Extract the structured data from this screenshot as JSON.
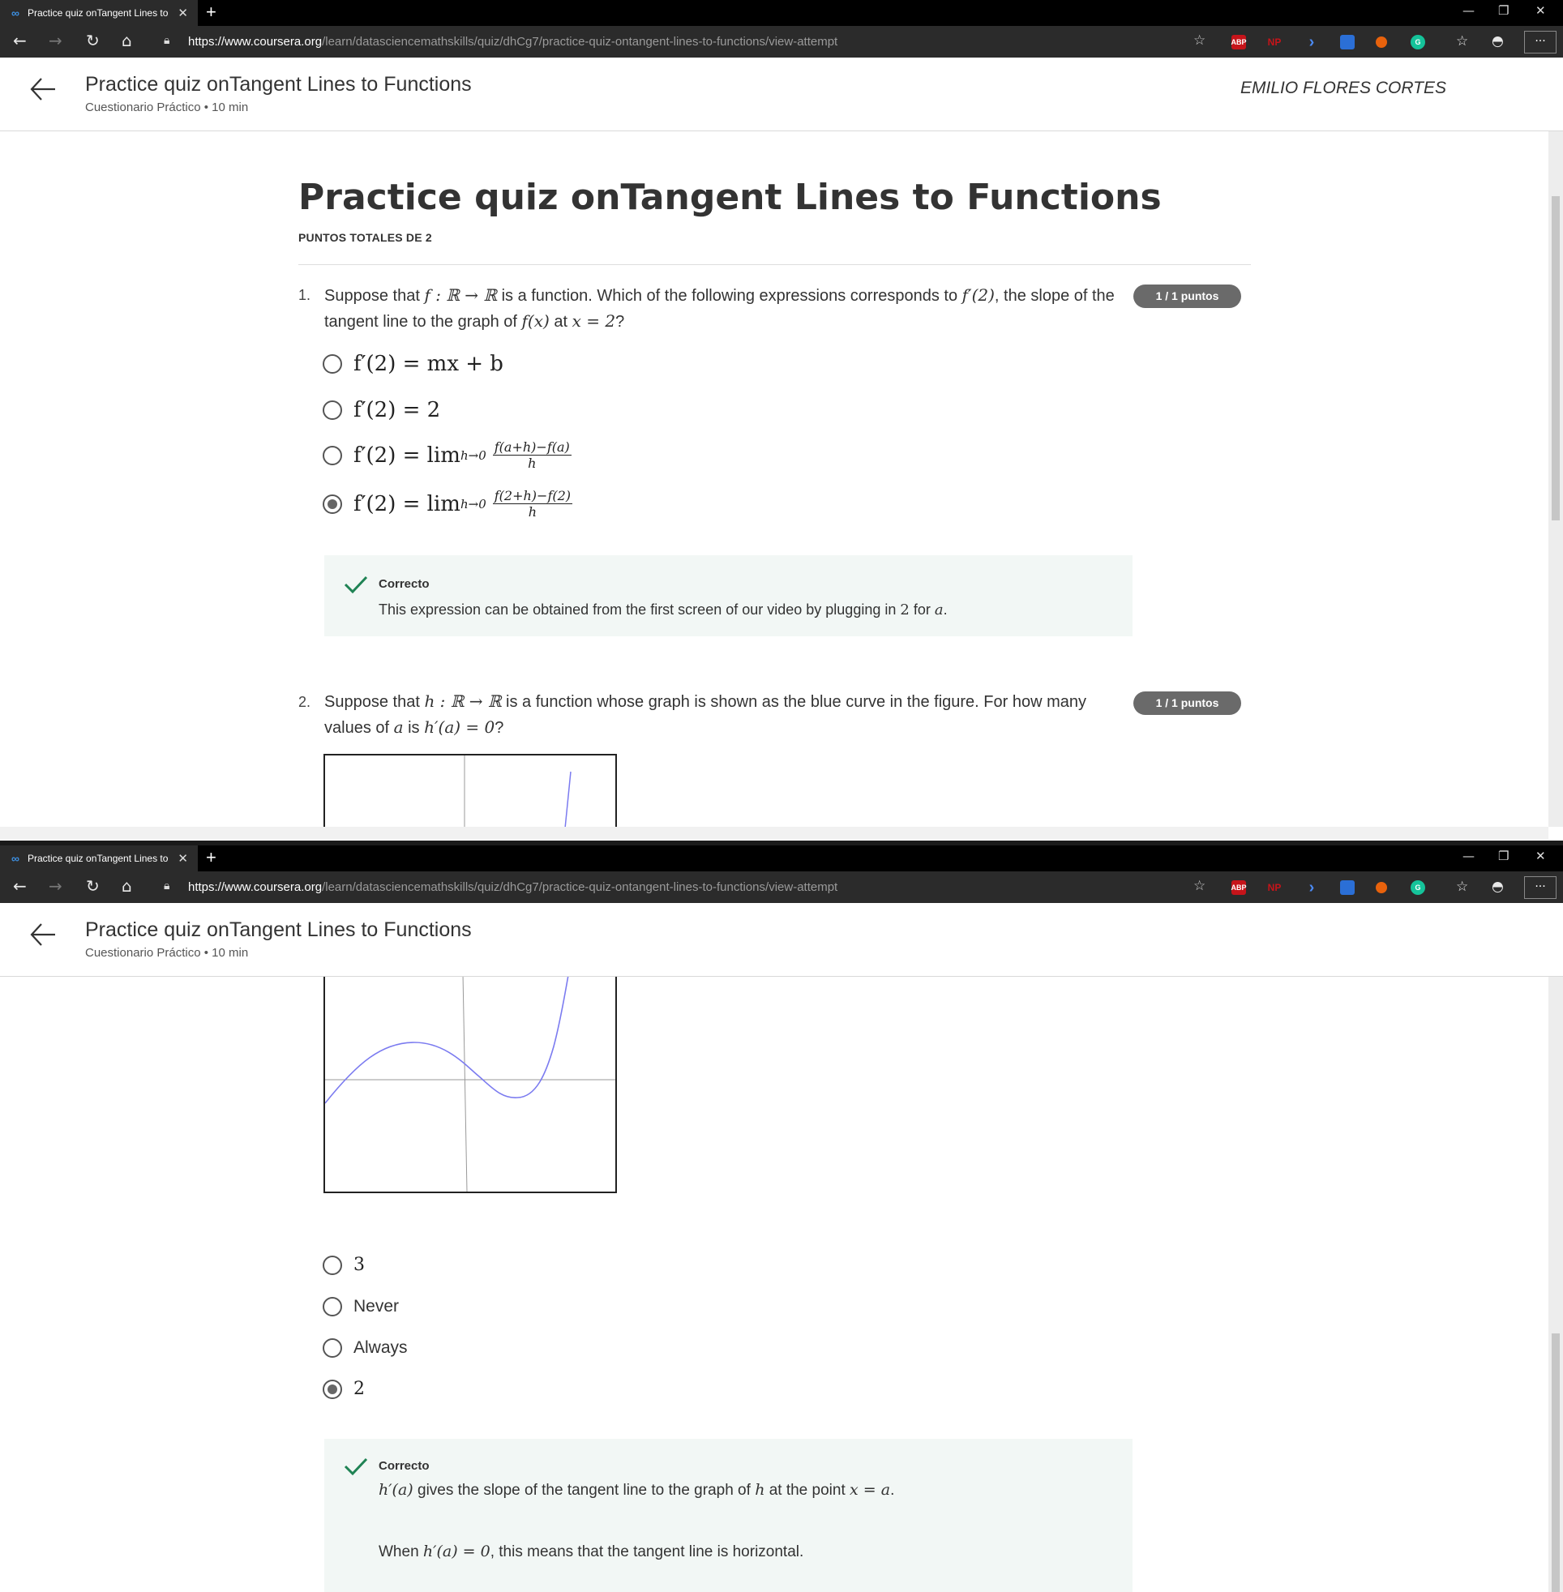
{
  "browser": {
    "tab_title": "Practice quiz onTangent Lines to",
    "tab_close": "✕",
    "new_tab": "+",
    "url_host": "https://www.coursera.org",
    "url_path": "/learn/datasciencemathskills/quiz/dhCg7/practice-quiz-ontangent-lines-to-functions/view-attempt",
    "menu_label": "···",
    "extensions": [
      {
        "name": "abp",
        "label": "ABP",
        "color": "#c6141a"
      },
      {
        "name": "np",
        "label": "NP",
        "color": "#c6141a"
      },
      {
        "name": "arrow",
        "label": "›",
        "color": "#2b6fd6"
      },
      {
        "name": "ext-blue",
        "label": "",
        "color": "#2b6fd6"
      },
      {
        "name": "ext-orange",
        "label": "",
        "color": "#e8620c"
      },
      {
        "name": "grammarly",
        "label": "G",
        "color": "#15c39a"
      }
    ]
  },
  "header": {
    "title": "Practice quiz onTangent Lines to Functions",
    "subtitle": "Cuestionario Práctico • 10 min",
    "user_name": "EMILIO FLORES CORTES"
  },
  "quiz": {
    "title": "Practice quiz onTangent Lines to Functions",
    "total_points": "PUNTOS TOTALES DE 2",
    "questions": [
      {
        "number": "1.",
        "text_a": "Suppose that ",
        "text_math1": "f : ℝ → ℝ",
        "text_b": " is a function. Which of the following expressions corresponds to ",
        "text_math2": "f′(2)",
        "text_c": ", the slope of the tangent line to the graph of ",
        "text_math3": "f(x)",
        "text_d": " at ",
        "text_math4": "x = 2",
        "text_e": "?",
        "badge": "1 / 1 puntos",
        "options": [
          {
            "label": "f′(2) = mx + b",
            "selected": false
          },
          {
            "label": "f′(2) = 2",
            "selected": false
          },
          {
            "label": "f′(2) = lim",
            "sub": "h→0",
            "num": "f(a+h)−f(a)",
            "den": "h",
            "selected": false
          },
          {
            "label": "f′(2) = lim",
            "sub": "h→0",
            "num": "f(2+h)−f(2)",
            "den": "h",
            "selected": true
          }
        ],
        "feedback_label": "Correcto",
        "feedback_a": "This expression can be obtained from the first screen of our video by plugging in ",
        "feedback_m1": "2",
        "feedback_b": " for ",
        "feedback_m2": "a",
        "feedback_c": "."
      },
      {
        "number": "2.",
        "text_a": "Suppose that ",
        "text_math1": "h : ℝ → ℝ",
        "text_b": " is a function whose graph is shown as the blue curve in the figure. For how many values of ",
        "text_math2": "a",
        "text_c": " is ",
        "text_math3": "h′(a) = 0",
        "text_d": "?",
        "badge": "1 / 1 puntos",
        "options": [
          {
            "label": "3",
            "selected": false,
            "math": true
          },
          {
            "label": "Never",
            "selected": false,
            "math": false
          },
          {
            "label": "Always",
            "selected": false,
            "math": false
          },
          {
            "label": "2",
            "selected": true,
            "math": true
          }
        ],
        "feedback_label": "Correcto",
        "feedback_line1_m1": "h′(a)",
        "feedback_line1_a": " gives the slope of the tangent line to the graph of ",
        "feedback_line1_m2": "h",
        "feedback_line1_b": " at the point ",
        "feedback_line1_m3": "x = a",
        "feedback_line1_c": ".",
        "feedback_line2_a": "When ",
        "feedback_line2_m1": "h′(a) = 0",
        "feedback_line2_b": ", this means that the tangent line is horizontal."
      }
    ]
  },
  "colors": {
    "correct_green": "#1f8354",
    "badge_gray": "#6a6a6a",
    "curve_blue": "#7b7bf0",
    "feedback_bg": "#f2f7f5"
  }
}
